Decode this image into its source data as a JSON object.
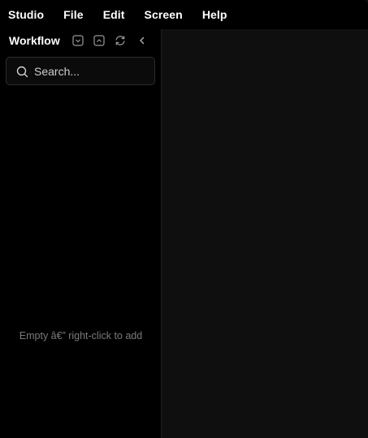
{
  "menubar": {
    "items": [
      {
        "label": "Studio"
      },
      {
        "label": "File"
      },
      {
        "label": "Edit"
      },
      {
        "label": "Screen"
      },
      {
        "label": "Help"
      }
    ]
  },
  "sidebar": {
    "title": "Workflow",
    "icons": [
      "collapse-all-icon",
      "expand-all-icon",
      "refresh-icon",
      "chevron-left-icon"
    ],
    "search": {
      "placeholder": "Search...",
      "value": ""
    },
    "empty_message": "Empty â€” right-click to add"
  },
  "colors": {
    "menubar_bg": "#000000",
    "sidebar_bg": "#000000",
    "main_bg": "#0f0f0f",
    "muted_text": "#7a7a7a"
  }
}
